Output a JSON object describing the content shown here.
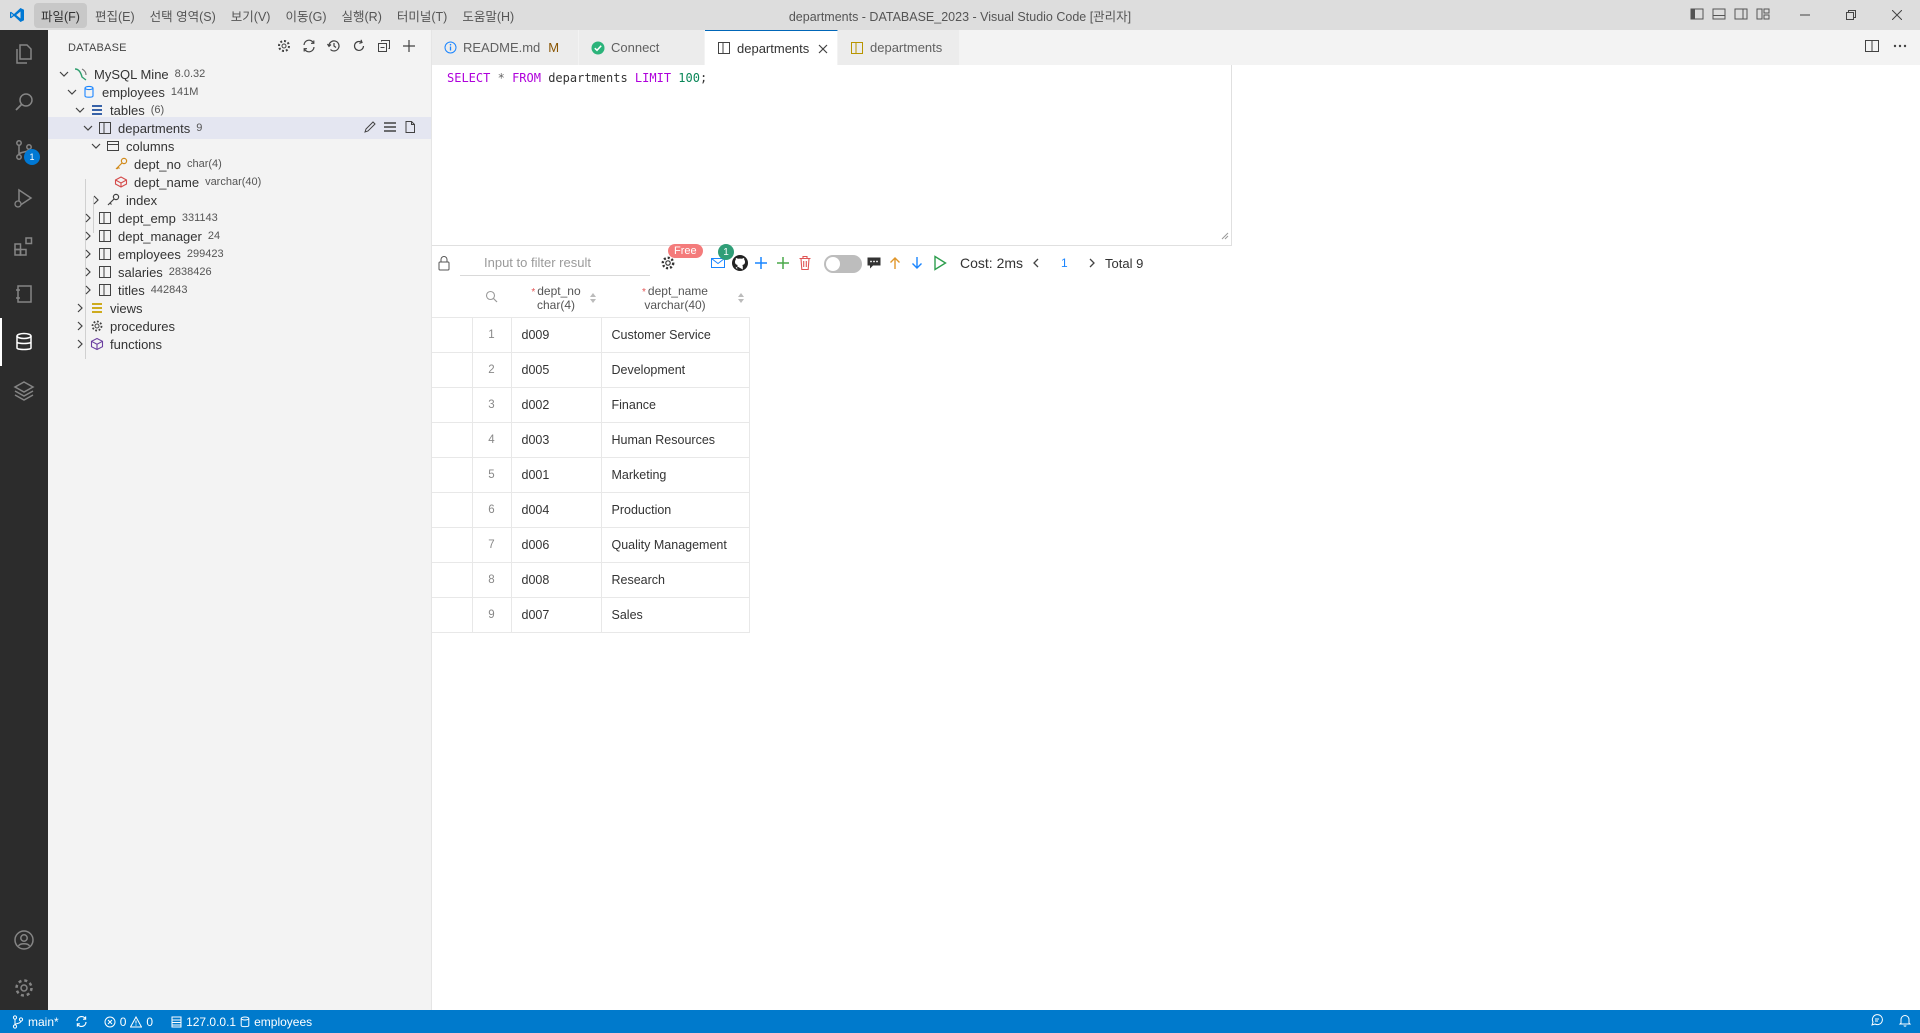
{
  "titlebar": {
    "menu": [
      "파일(F)",
      "편집(E)",
      "선택 영역(S)",
      "보기(V)",
      "이동(G)",
      "실행(R)",
      "터미널(T)",
      "도움말(H)"
    ],
    "title": "departments - DATABASE_2023 - Visual Studio Code [관리자]"
  },
  "activitybar": {
    "scm_badge": "1"
  },
  "sidebar": {
    "header": "DATABASE",
    "tree": {
      "connection": {
        "label": "MySQL Mine",
        "desc": "8.0.32"
      },
      "database": {
        "label": "employees",
        "desc": "141M"
      },
      "tables": {
        "label": "tables",
        "desc": "(6)"
      },
      "departments": {
        "label": "departments",
        "desc": "9"
      },
      "columns": {
        "label": "columns"
      },
      "col1": {
        "label": "dept_no",
        "desc": "char(4)"
      },
      "col2": {
        "label": "dept_name",
        "desc": "varchar(40)"
      },
      "index": {
        "label": "index"
      },
      "dept_emp": {
        "label": "dept_emp",
        "desc": "331143"
      },
      "dept_manager": {
        "label": "dept_manager",
        "desc": "24"
      },
      "employees": {
        "label": "employees",
        "desc": "299423"
      },
      "salaries": {
        "label": "salaries",
        "desc": "2838426"
      },
      "titles": {
        "label": "titles",
        "desc": "442843"
      },
      "views": {
        "label": "views"
      },
      "procedures": {
        "label": "procedures"
      },
      "functions": {
        "label": "functions"
      }
    }
  },
  "tabs": [
    {
      "label": "README.md",
      "modified": "M"
    },
    {
      "label": "Connect"
    },
    {
      "label": "departments"
    },
    {
      "label": "departments"
    }
  ],
  "editor": {
    "sql": {
      "select": "SELECT",
      "star": "*",
      "from": "FROM",
      "table": "departments",
      "limit": "LIMIT",
      "count": "100",
      "semi": ";"
    }
  },
  "toolbar": {
    "filter_placeholder": "Input to filter result",
    "free_badge": "Free",
    "mail_badge": "1",
    "cost": "Cost: 2ms",
    "page": "1",
    "total": "Total 9"
  },
  "result": {
    "columns": [
      {
        "name": "dept_no",
        "type": "char(4)"
      },
      {
        "name": "dept_name",
        "type": "varchar(40)"
      }
    ],
    "rows": [
      {
        "n": "1",
        "dept_no": "d009",
        "dept_name": "Customer Service"
      },
      {
        "n": "2",
        "dept_no": "d005",
        "dept_name": "Development"
      },
      {
        "n": "3",
        "dept_no": "d002",
        "dept_name": "Finance"
      },
      {
        "n": "4",
        "dept_no": "d003",
        "dept_name": "Human Resources"
      },
      {
        "n": "5",
        "dept_no": "d001",
        "dept_name": "Marketing"
      },
      {
        "n": "6",
        "dept_no": "d004",
        "dept_name": "Production"
      },
      {
        "n": "7",
        "dept_no": "d006",
        "dept_name": "Quality Management"
      },
      {
        "n": "8",
        "dept_no": "d008",
        "dept_name": "Research"
      },
      {
        "n": "9",
        "dept_no": "d007",
        "dept_name": "Sales"
      }
    ]
  },
  "statusbar": {
    "branch": "main*",
    "errors": "0",
    "warnings": "0",
    "host": "127.0.0.1",
    "database": "employees"
  },
  "colors": {
    "accent": "#007acc",
    "activity_bar": "#2c2c2c",
    "selection": "#e4e6f1",
    "free_badge": "#f47b7b",
    "sql_keyword": "#af00db"
  }
}
